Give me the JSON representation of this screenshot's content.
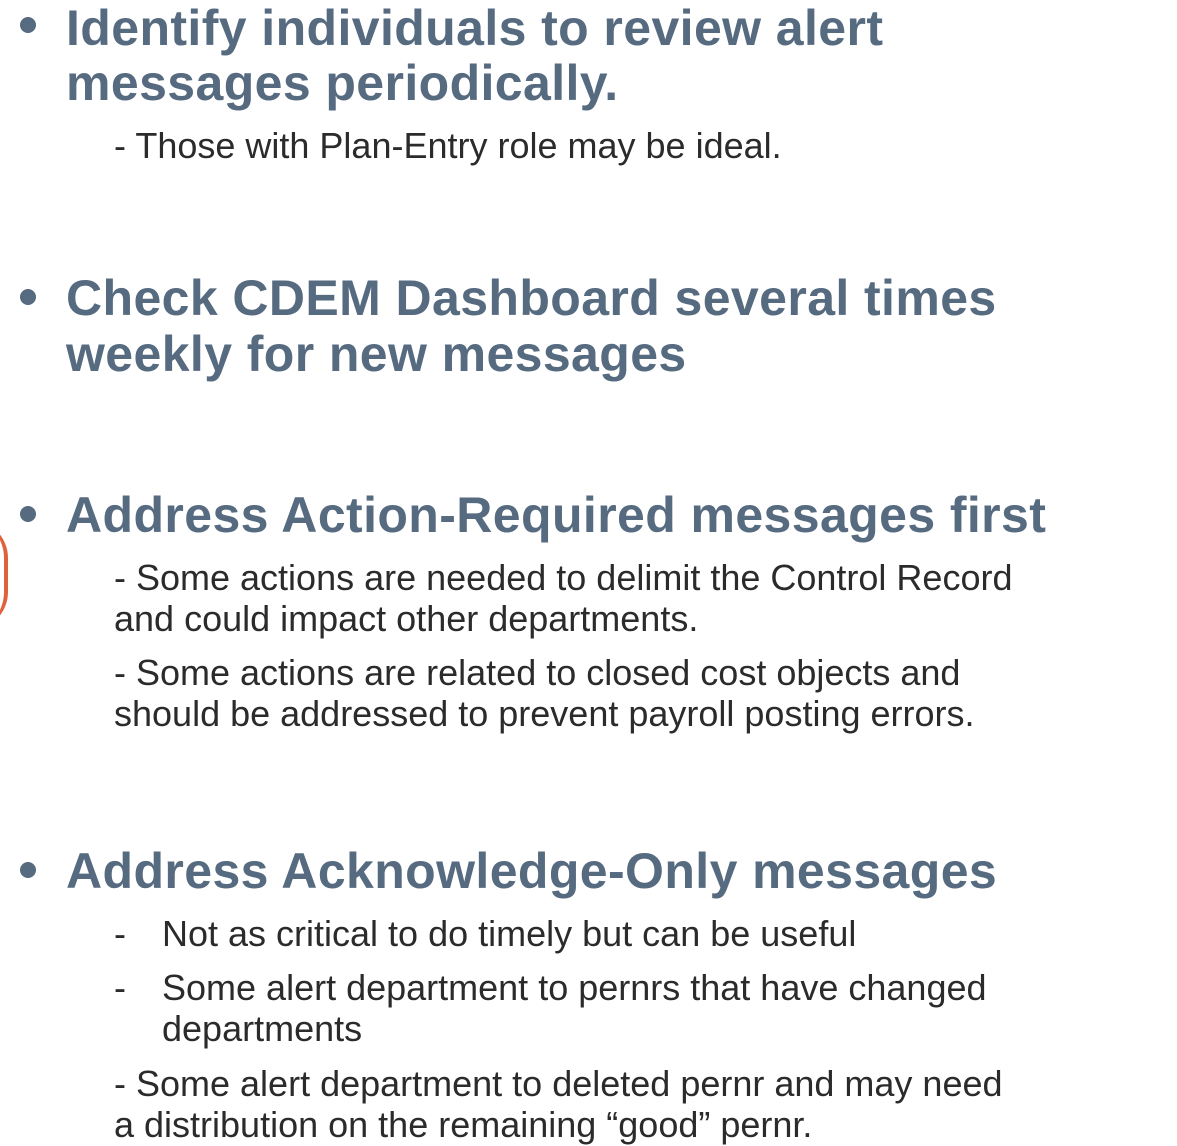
{
  "bullets": [
    {
      "heading_line1": "Identify individuals to review alert",
      "heading_line2": "messages periodically.",
      "sub": "- Those with Plan-Entry role may be ideal."
    },
    {
      "heading_line1": "Check CDEM Dashboard several times",
      "heading_line2": "weekly for new messages"
    },
    {
      "heading": "Address Action-Required messages first",
      "sub1_line1": "- Some actions are needed to delimit the Control Record",
      "sub1_line2": "and could impact other departments.",
      "sub2_line1": "- Some actions are related to closed cost objects and",
      "sub2_line2": "should be addressed to prevent payroll posting errors."
    },
    {
      "heading": "Address Acknowledge-Only messages",
      "dash": "-",
      "item1": "Not as critical to do timely but can be useful",
      "item2_line1": "Some alert department to pernrs that have changed",
      "item2_line2": "departments",
      "item3_line1": "-  Some alert department to deleted pernr and may need",
      "item3_line2": "a distribution on the remaining “good” pernr."
    }
  ],
  "colors": {
    "heading": "#566a80",
    "body_text": "#2b2b2b",
    "accent": "#e0623a"
  }
}
